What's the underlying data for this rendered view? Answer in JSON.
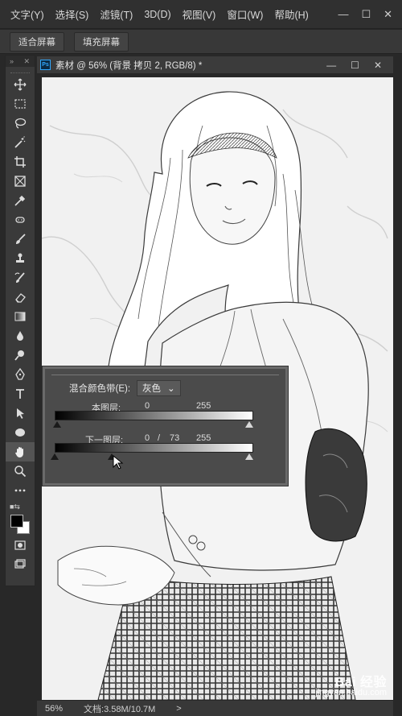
{
  "menu": [
    "文字(Y)",
    "选择(S)",
    "滤镜(T)",
    "3D(D)",
    "视图(V)",
    "窗口(W)",
    "帮助(H)"
  ],
  "window_controls": [
    "—",
    "☐",
    "✕"
  ],
  "options": {
    "fit_screen": "适合屏幕",
    "fill_screen": "填充屏幕"
  },
  "toolbar": {
    "collapse": "»",
    "close": "✕"
  },
  "document": {
    "badge": "Ps",
    "tab_title": "素材 @ 56% (背景 拷贝 2, RGB/8) *",
    "controls": [
      "—",
      "☐",
      "✕"
    ]
  },
  "status": {
    "zoom": "56%",
    "doc_size": "文档:3.58M/10.7M",
    "arrow": ">"
  },
  "blend_panel": {
    "blend_if_label": "混合颜色带(E):",
    "blend_if_value": "灰色",
    "this_layer_label": "本图层:",
    "this_layer_low": "0",
    "this_layer_high": "255",
    "underlying_label": "下一图层:",
    "underlying_low": "0",
    "underlying_sep": "/",
    "underlying_split": "73",
    "underlying_high": "255"
  },
  "watermark": {
    "logo": "Bai 经验",
    "site": "jingyan.baidu.com"
  },
  "colors": {
    "foreground": "#000000",
    "background": "#ffffff",
    "accent": "#31a8ff"
  },
  "icons": [
    "move-icon",
    "marquee-icon",
    "lasso-icon",
    "magic-wand-icon",
    "crop-icon",
    "frame-icon",
    "eyedropper-icon",
    "spot-heal-icon",
    "brush-icon",
    "stamp-icon",
    "history-brush-icon",
    "eraser-icon",
    "gradient-icon",
    "blur-icon",
    "dodge-icon",
    "pen-icon",
    "type-icon",
    "path-select-icon",
    "ellipse-icon",
    "hand-icon",
    "zoom-icon",
    "more-icon"
  ]
}
